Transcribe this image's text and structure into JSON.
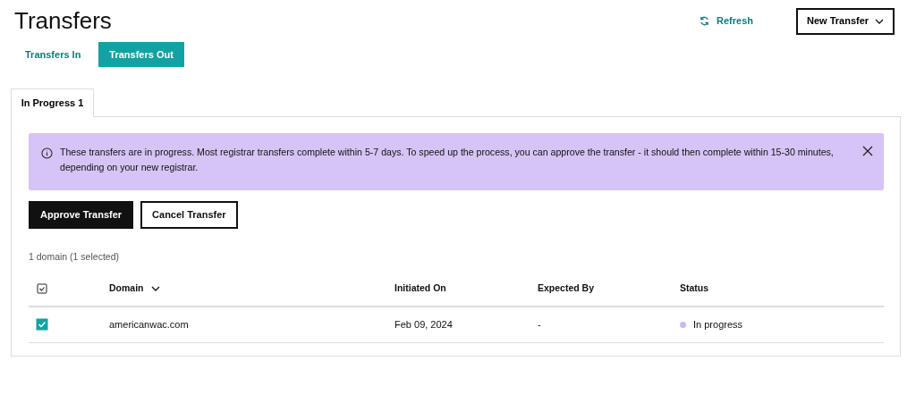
{
  "title": "Transfers",
  "refresh": {
    "label": "Refresh"
  },
  "new_transfer": {
    "label": "New Transfer"
  },
  "tabs": [
    {
      "label": "Transfers In",
      "selected": false
    },
    {
      "label": "Transfers Out",
      "selected": true
    }
  ],
  "panel_tab": {
    "label": "In Progress 1"
  },
  "alert": {
    "text": "These transfers are in progress. Most registrar transfers complete within 5-7 days. To speed up the process, you can approve the transfer - it should then complete within 15-30 minutes, depending on your new registrar."
  },
  "actions": [
    {
      "label": "Approve Transfer",
      "kind": "primary"
    },
    {
      "label": "Cancel Transfer",
      "kind": "outline"
    }
  ],
  "count": "1 domain (1 selected)",
  "table": {
    "select_all_checked": true,
    "columns": [
      {
        "label": "Domain",
        "sortable": true
      },
      {
        "label": "Initiated On",
        "sortable": false
      },
      {
        "label": "Expected By",
        "sortable": false
      },
      {
        "label": "Status",
        "sortable": false
      }
    ],
    "rows": [
      {
        "checked": true,
        "domain": "americanwac.com",
        "initiated": "Feb 09, 2024",
        "expected": "-",
        "status": "In progress",
        "color": "#c9b8ee"
      }
    ]
  }
}
